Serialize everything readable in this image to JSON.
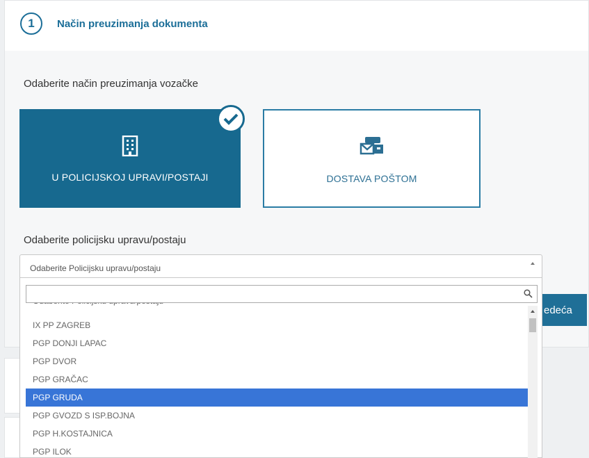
{
  "step": {
    "number": "1",
    "title": "Način preuzimanja dokumenta"
  },
  "delivery": {
    "prompt": "Odaberite način preuzimanja vozačke",
    "options": [
      {
        "label": "U POLICIJSKOJ UPRAVI/POSTAJI",
        "icon": "building-icon",
        "selected": true
      },
      {
        "label": "DOSTAVA POŠTOM",
        "icon": "mail-delivery-icon",
        "selected": false
      }
    ]
  },
  "station": {
    "prompt": "Odaberite policijsku upravu/postaju",
    "selected_value": "Odaberite Policijsku upravu/postaju",
    "search_value": "",
    "results": [
      "Odaberite Policijsku upravu/postaju",
      "IX PP ZAGREB",
      "PGP DONJI LAPAC",
      "PGP DVOR",
      "PGP GRAČAC",
      "PGP GRUDA",
      "PGP GVOZD S ISP.BOJNA",
      "PGP H.KOSTAJNICA",
      "PGP ILOK"
    ],
    "highlighted": "PGP GRUDA"
  },
  "actions": {
    "next_label": "edeća"
  },
  "colors": {
    "primary": "#17698f",
    "highlight": "#3875d7"
  }
}
